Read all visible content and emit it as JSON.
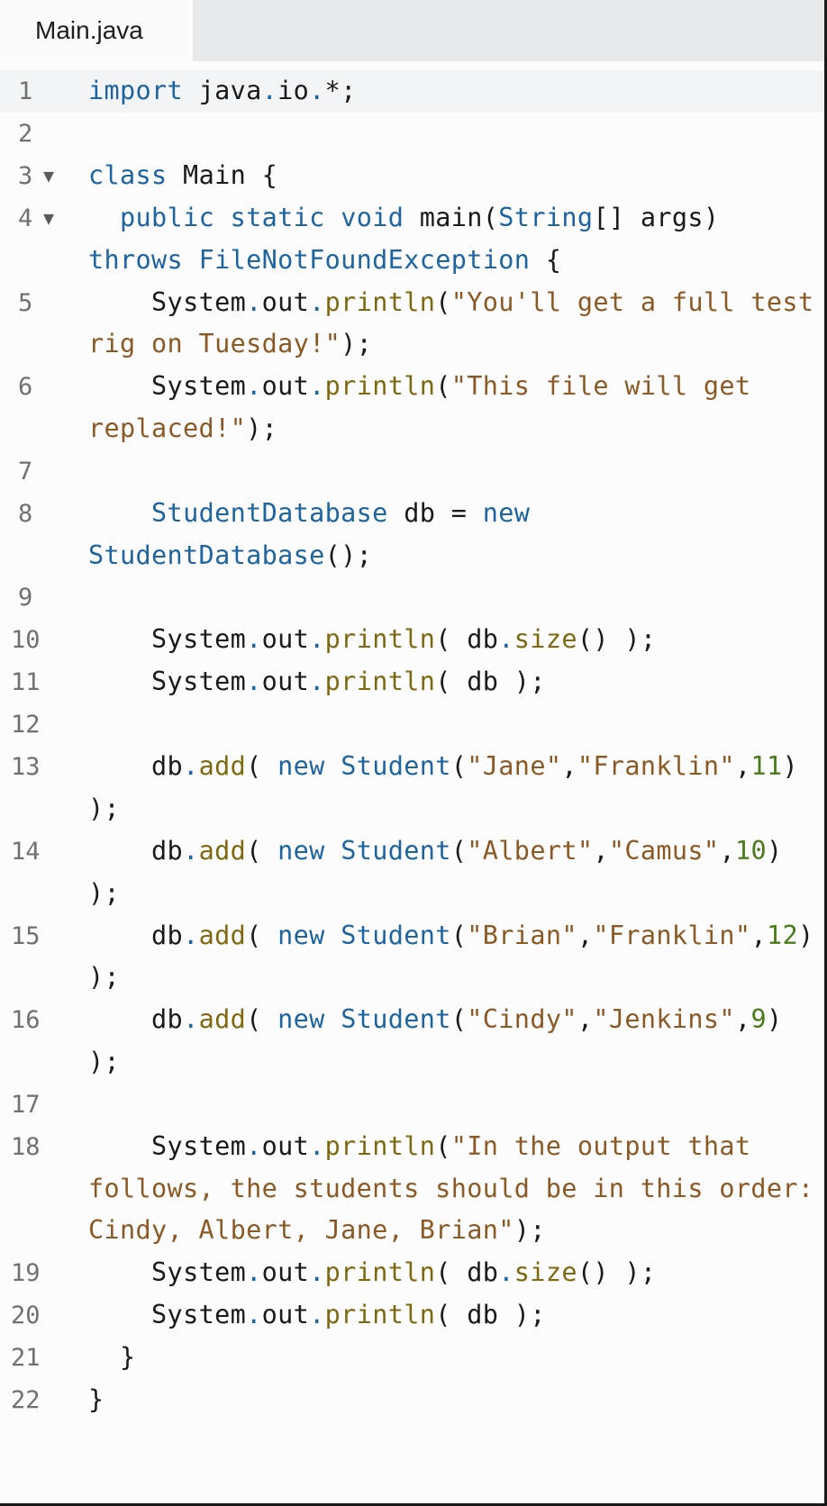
{
  "tabs": [
    {
      "label": "Main.java",
      "active": true
    }
  ],
  "colors": {
    "keyword": "#1d64a0",
    "string": "#8b5a24",
    "method": "#7d6a10",
    "number": "#4a7a1a",
    "plain": "#1a1a1a",
    "gutter": "#707070",
    "active_line_bg": "#f2f4f5",
    "tabbar_bg": "#e8e9eb"
  },
  "editor": {
    "active_line": 1,
    "lines": [
      {
        "n": "1",
        "fold": false,
        "tokens": [
          [
            "kw",
            "import"
          ],
          [
            "plain",
            " java"
          ],
          [
            "dot",
            "."
          ],
          [
            "plain",
            "io"
          ],
          [
            "dot",
            "."
          ],
          [
            "plain",
            "*;"
          ]
        ]
      },
      {
        "n": "2",
        "fold": false,
        "tokens": []
      },
      {
        "n": "3",
        "fold": true,
        "tokens": [
          [
            "kw",
            "class"
          ],
          [
            "plain",
            " Main {"
          ]
        ]
      },
      {
        "n": "4",
        "fold": true,
        "tokens": [
          [
            "plain",
            "  "
          ],
          [
            "kw",
            "public"
          ],
          [
            "plain",
            " "
          ],
          [
            "kw",
            "static"
          ],
          [
            "plain",
            " "
          ],
          [
            "kw",
            "void"
          ],
          [
            "plain",
            " main("
          ],
          [
            "type",
            "String"
          ],
          [
            "plain",
            "[] args) "
          ],
          [
            "kw",
            "throws"
          ],
          [
            "plain",
            " "
          ],
          [
            "type",
            "FileNotFoundException"
          ],
          [
            "plain",
            " {"
          ]
        ]
      },
      {
        "n": "5",
        "fold": false,
        "tokens": [
          [
            "plain",
            "    System"
          ],
          [
            "dot",
            "."
          ],
          [
            "plain",
            "out"
          ],
          [
            "dot",
            "."
          ],
          [
            "fn",
            "println"
          ],
          [
            "plain",
            "("
          ],
          [
            "str",
            "\"You'll get a full test rig on Tuesday!\""
          ],
          [
            "plain",
            ");"
          ]
        ]
      },
      {
        "n": "6",
        "fold": false,
        "tokens": [
          [
            "plain",
            "    System"
          ],
          [
            "dot",
            "."
          ],
          [
            "plain",
            "out"
          ],
          [
            "dot",
            "."
          ],
          [
            "fn",
            "println"
          ],
          [
            "plain",
            "("
          ],
          [
            "str",
            "\"This file will get replaced!\""
          ],
          [
            "plain",
            ");"
          ]
        ]
      },
      {
        "n": "7",
        "fold": false,
        "tokens": []
      },
      {
        "n": "8",
        "fold": false,
        "tokens": [
          [
            "plain",
            "    "
          ],
          [
            "type",
            "StudentDatabase"
          ],
          [
            "plain",
            " db = "
          ],
          [
            "kw",
            "new"
          ],
          [
            "plain",
            " "
          ],
          [
            "type",
            "StudentDatabase"
          ],
          [
            "plain",
            "();"
          ]
        ]
      },
      {
        "n": "9",
        "fold": false,
        "tokens": []
      },
      {
        "n": "10",
        "fold": false,
        "tokens": [
          [
            "plain",
            "    System"
          ],
          [
            "dot",
            "."
          ],
          [
            "plain",
            "out"
          ],
          [
            "dot",
            "."
          ],
          [
            "fn",
            "println"
          ],
          [
            "plain",
            "( db"
          ],
          [
            "dot",
            "."
          ],
          [
            "fn",
            "size"
          ],
          [
            "plain",
            "() );"
          ]
        ]
      },
      {
        "n": "11",
        "fold": false,
        "tokens": [
          [
            "plain",
            "    System"
          ],
          [
            "dot",
            "."
          ],
          [
            "plain",
            "out"
          ],
          [
            "dot",
            "."
          ],
          [
            "fn",
            "println"
          ],
          [
            "plain",
            "( db );"
          ]
        ]
      },
      {
        "n": "12",
        "fold": false,
        "tokens": []
      },
      {
        "n": "13",
        "fold": false,
        "tokens": [
          [
            "plain",
            "    db"
          ],
          [
            "dot",
            "."
          ],
          [
            "fn",
            "add"
          ],
          [
            "plain",
            "( "
          ],
          [
            "kw",
            "new"
          ],
          [
            "plain",
            " "
          ],
          [
            "type",
            "Student"
          ],
          [
            "plain",
            "("
          ],
          [
            "str",
            "\"Jane\""
          ],
          [
            "plain",
            ","
          ],
          [
            "str",
            "\"Franklin\""
          ],
          [
            "plain",
            ","
          ],
          [
            "num",
            "11"
          ],
          [
            "plain",
            ") );"
          ]
        ]
      },
      {
        "n": "14",
        "fold": false,
        "tokens": [
          [
            "plain",
            "    db"
          ],
          [
            "dot",
            "."
          ],
          [
            "fn",
            "add"
          ],
          [
            "plain",
            "( "
          ],
          [
            "kw",
            "new"
          ],
          [
            "plain",
            " "
          ],
          [
            "type",
            "Student"
          ],
          [
            "plain",
            "("
          ],
          [
            "str",
            "\"Albert\""
          ],
          [
            "plain",
            ","
          ],
          [
            "str",
            "\"Camus\""
          ],
          [
            "plain",
            ","
          ],
          [
            "num",
            "10"
          ],
          [
            "plain",
            ") );"
          ]
        ]
      },
      {
        "n": "15",
        "fold": false,
        "tokens": [
          [
            "plain",
            "    db"
          ],
          [
            "dot",
            "."
          ],
          [
            "fn",
            "add"
          ],
          [
            "plain",
            "( "
          ],
          [
            "kw",
            "new"
          ],
          [
            "plain",
            " "
          ],
          [
            "type",
            "Student"
          ],
          [
            "plain",
            "("
          ],
          [
            "str",
            "\"Brian\""
          ],
          [
            "plain",
            ","
          ],
          [
            "str",
            "\"Franklin\""
          ],
          [
            "plain",
            ","
          ],
          [
            "num",
            "12"
          ],
          [
            "plain",
            ") );"
          ]
        ]
      },
      {
        "n": "16",
        "fold": false,
        "tokens": [
          [
            "plain",
            "    db"
          ],
          [
            "dot",
            "."
          ],
          [
            "fn",
            "add"
          ],
          [
            "plain",
            "( "
          ],
          [
            "kw",
            "new"
          ],
          [
            "plain",
            " "
          ],
          [
            "type",
            "Student"
          ],
          [
            "plain",
            "("
          ],
          [
            "str",
            "\"Cindy\""
          ],
          [
            "plain",
            ","
          ],
          [
            "str",
            "\"Jenkins\""
          ],
          [
            "plain",
            ","
          ],
          [
            "num",
            "9"
          ],
          [
            "plain",
            ") );"
          ]
        ]
      },
      {
        "n": "17",
        "fold": false,
        "tokens": []
      },
      {
        "n": "18",
        "fold": false,
        "tokens": [
          [
            "plain",
            "    System"
          ],
          [
            "dot",
            "."
          ],
          [
            "plain",
            "out"
          ],
          [
            "dot",
            "."
          ],
          [
            "fn",
            "println"
          ],
          [
            "plain",
            "("
          ],
          [
            "str",
            "\"In the output that follows, the students should be in this order: Cindy, Albert, Jane, Brian\""
          ],
          [
            "plain",
            ");"
          ]
        ]
      },
      {
        "n": "19",
        "fold": false,
        "tokens": [
          [
            "plain",
            "    System"
          ],
          [
            "dot",
            "."
          ],
          [
            "plain",
            "out"
          ],
          [
            "dot",
            "."
          ],
          [
            "fn",
            "println"
          ],
          [
            "plain",
            "( db"
          ],
          [
            "dot",
            "."
          ],
          [
            "fn",
            "size"
          ],
          [
            "plain",
            "() );"
          ]
        ]
      },
      {
        "n": "20",
        "fold": false,
        "tokens": [
          [
            "plain",
            "    System"
          ],
          [
            "dot",
            "."
          ],
          [
            "plain",
            "out"
          ],
          [
            "dot",
            "."
          ],
          [
            "fn",
            "println"
          ],
          [
            "plain",
            "( db );"
          ]
        ]
      },
      {
        "n": "21",
        "fold": false,
        "tokens": [
          [
            "plain",
            "  }"
          ]
        ]
      },
      {
        "n": "22",
        "fold": false,
        "tokens": [
          [
            "plain",
            "}"
          ]
        ]
      }
    ],
    "fold_glyph": "▼"
  }
}
